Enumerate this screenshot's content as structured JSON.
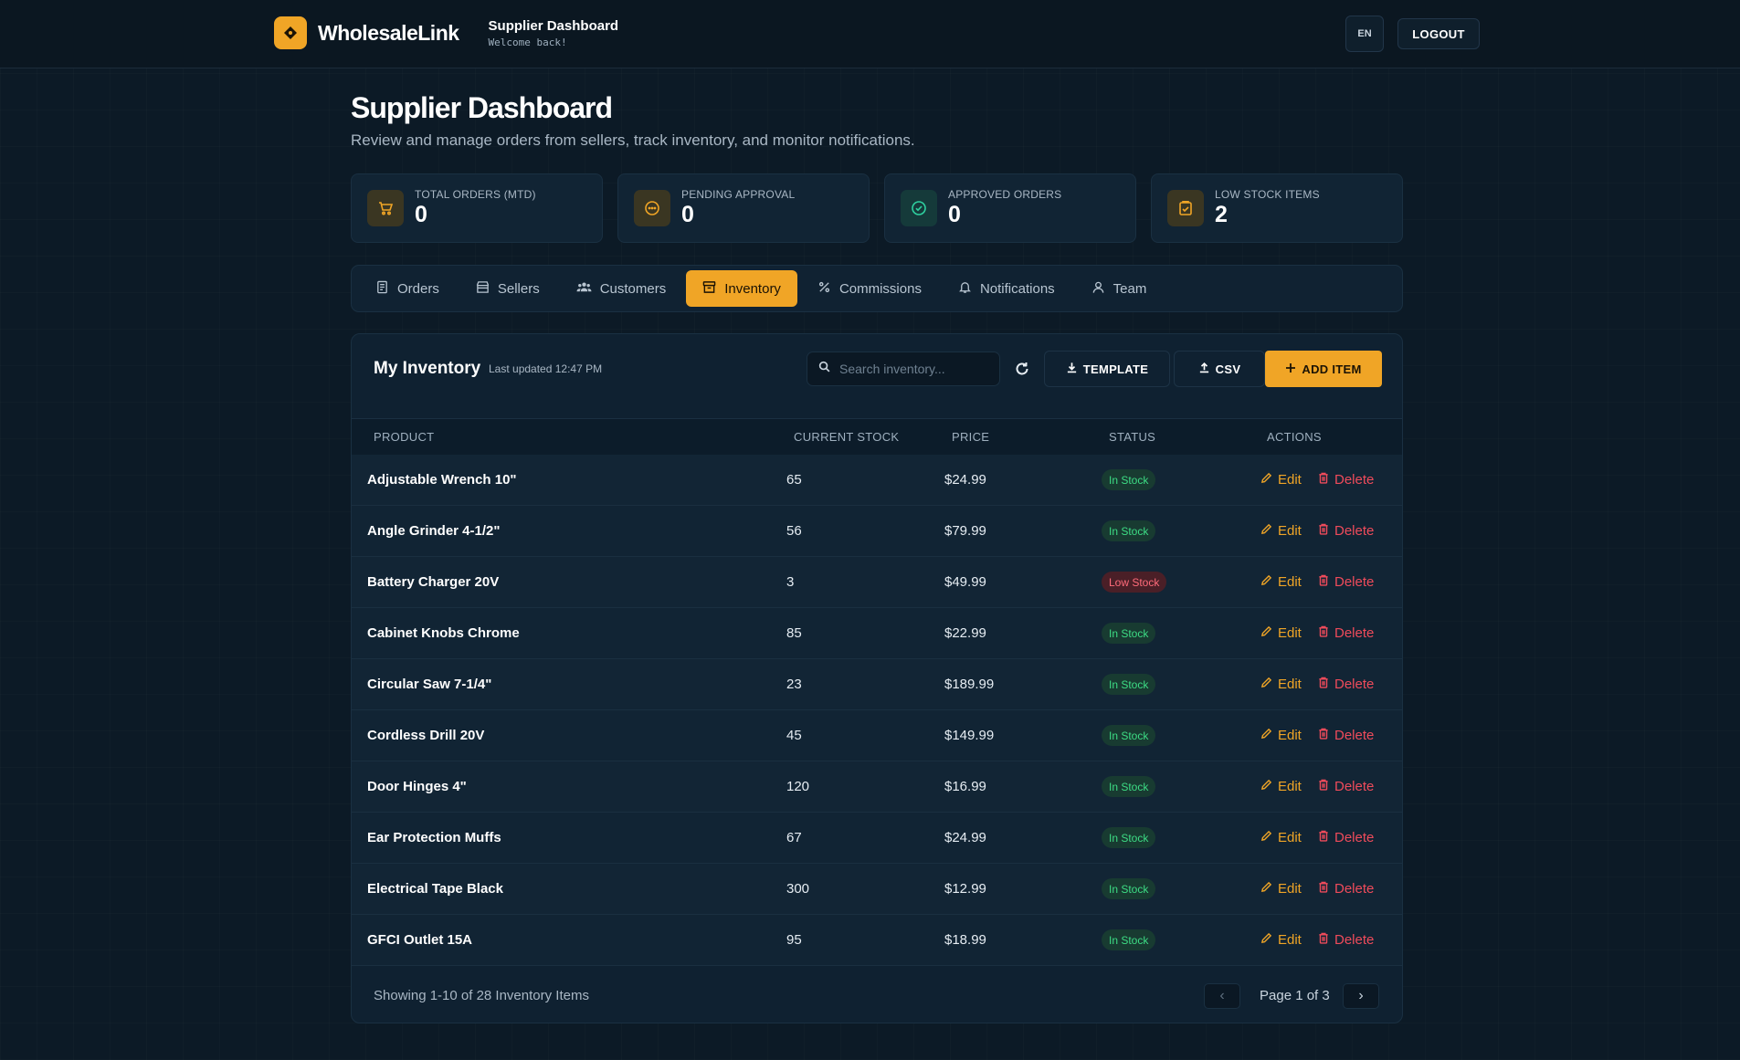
{
  "header": {
    "brand": "WholesaleLink",
    "title": "Supplier Dashboard",
    "subtitle": "Welcome back!",
    "language": "EN",
    "logout_label": "LOGOUT"
  },
  "page": {
    "title": "Supplier Dashboard",
    "subtitle": "Review and manage orders from sellers, track inventory, and monitor notifications."
  },
  "stats": [
    {
      "label": "TOTAL ORDERS (MTD)",
      "value": "0",
      "icon": "cart-icon"
    },
    {
      "label": "PENDING APPROVAL",
      "value": "0",
      "icon": "clock-dots-icon"
    },
    {
      "label": "APPROVED ORDERS",
      "value": "0",
      "icon": "check-circle-icon"
    },
    {
      "label": "LOW STOCK ITEMS",
      "value": "2",
      "icon": "clipboard-icon"
    }
  ],
  "tabs": [
    {
      "label": "Orders",
      "icon": "receipt-icon",
      "active": false
    },
    {
      "label": "Sellers",
      "icon": "store-icon",
      "active": false
    },
    {
      "label": "Customers",
      "icon": "users-icon",
      "active": false
    },
    {
      "label": "Inventory",
      "icon": "box-icon",
      "active": true
    },
    {
      "label": "Commissions",
      "icon": "percent-icon",
      "active": false
    },
    {
      "label": "Notifications",
      "icon": "bell-icon",
      "active": false
    },
    {
      "label": "Team",
      "icon": "user-icon",
      "active": false
    }
  ],
  "inventory": {
    "title": "My Inventory",
    "last_updated": "Last updated 12:47 PM",
    "search_placeholder": "Search inventory...",
    "template_label": "TEMPLATE",
    "csv_label": "CSV",
    "add_label": "ADD ITEM",
    "columns": [
      "PRODUCT",
      "CURRENT STOCK",
      "PRICE",
      "STATUS",
      "ACTIONS"
    ],
    "edit_label": "Edit",
    "delete_label": "Delete",
    "rows": [
      {
        "product": "Adjustable Wrench 10\"",
        "stock": "65",
        "price": "$24.99",
        "status": "In Stock"
      },
      {
        "product": "Angle Grinder 4-1/2\"",
        "stock": "56",
        "price": "$79.99",
        "status": "In Stock"
      },
      {
        "product": "Battery Charger 20V",
        "stock": "3",
        "price": "$49.99",
        "status": "Low Stock"
      },
      {
        "product": "Cabinet Knobs Chrome",
        "stock": "85",
        "price": "$22.99",
        "status": "In Stock"
      },
      {
        "product": "Circular Saw 7-1/4\"",
        "stock": "23",
        "price": "$189.99",
        "status": "In Stock"
      },
      {
        "product": "Cordless Drill 20V",
        "stock": "45",
        "price": "$149.99",
        "status": "In Stock"
      },
      {
        "product": "Door Hinges 4\"",
        "stock": "120",
        "price": "$16.99",
        "status": "In Stock"
      },
      {
        "product": "Ear Protection Muffs",
        "stock": "67",
        "price": "$24.99",
        "status": "In Stock"
      },
      {
        "product": "Electrical Tape Black",
        "stock": "300",
        "price": "$12.99",
        "status": "In Stock"
      },
      {
        "product": "GFCI Outlet 15A",
        "stock": "95",
        "price": "$18.99",
        "status": "In Stock"
      }
    ],
    "footer_text": "Showing 1-10 of 28 Inventory Items",
    "page_text": "Page 1 of 3"
  },
  "colors": {
    "accent": "#f0a526",
    "background": "#0c1a26",
    "in_stock": "#3ddc84",
    "low_stock": "#ff6b7a",
    "danger": "#ef4b5b"
  }
}
